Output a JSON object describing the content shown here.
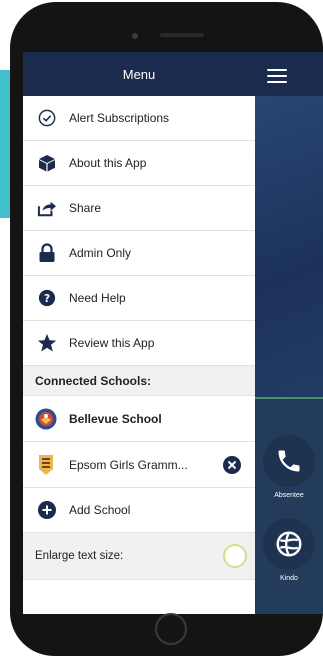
{
  "colors": {
    "teal_banner": "#3fc1c9",
    "nav_dark": "#1b2b4d",
    "toggle_border": "#cfe08a"
  },
  "drawer": {
    "title": "Menu",
    "items": [
      {
        "label": "Alert Subscriptions",
        "icon": "check-circle-icon"
      },
      {
        "label": "About this App",
        "icon": "cube-icon"
      },
      {
        "label": "Share",
        "icon": "share-icon"
      },
      {
        "label": "Admin Only",
        "icon": "lock-icon"
      },
      {
        "label": "Need Help",
        "icon": "question-circle-icon"
      },
      {
        "label": "Review this App",
        "icon": "star-icon"
      }
    ],
    "connected_schools_heading": "Connected Schools:",
    "schools": [
      {
        "name": "Bellevue School",
        "icon": "school-crest-icon"
      },
      {
        "name": "Epsom Girls Gramm...",
        "icon": "school-crest-icon",
        "removable": true
      }
    ],
    "add_school_label": "Add School",
    "enlarge_label": "Enlarge text size:"
  },
  "app_tiles": [
    {
      "label": "Absentee",
      "icon": "phone-icon"
    },
    {
      "label": "Kindo",
      "icon": "kindo-icon"
    }
  ]
}
